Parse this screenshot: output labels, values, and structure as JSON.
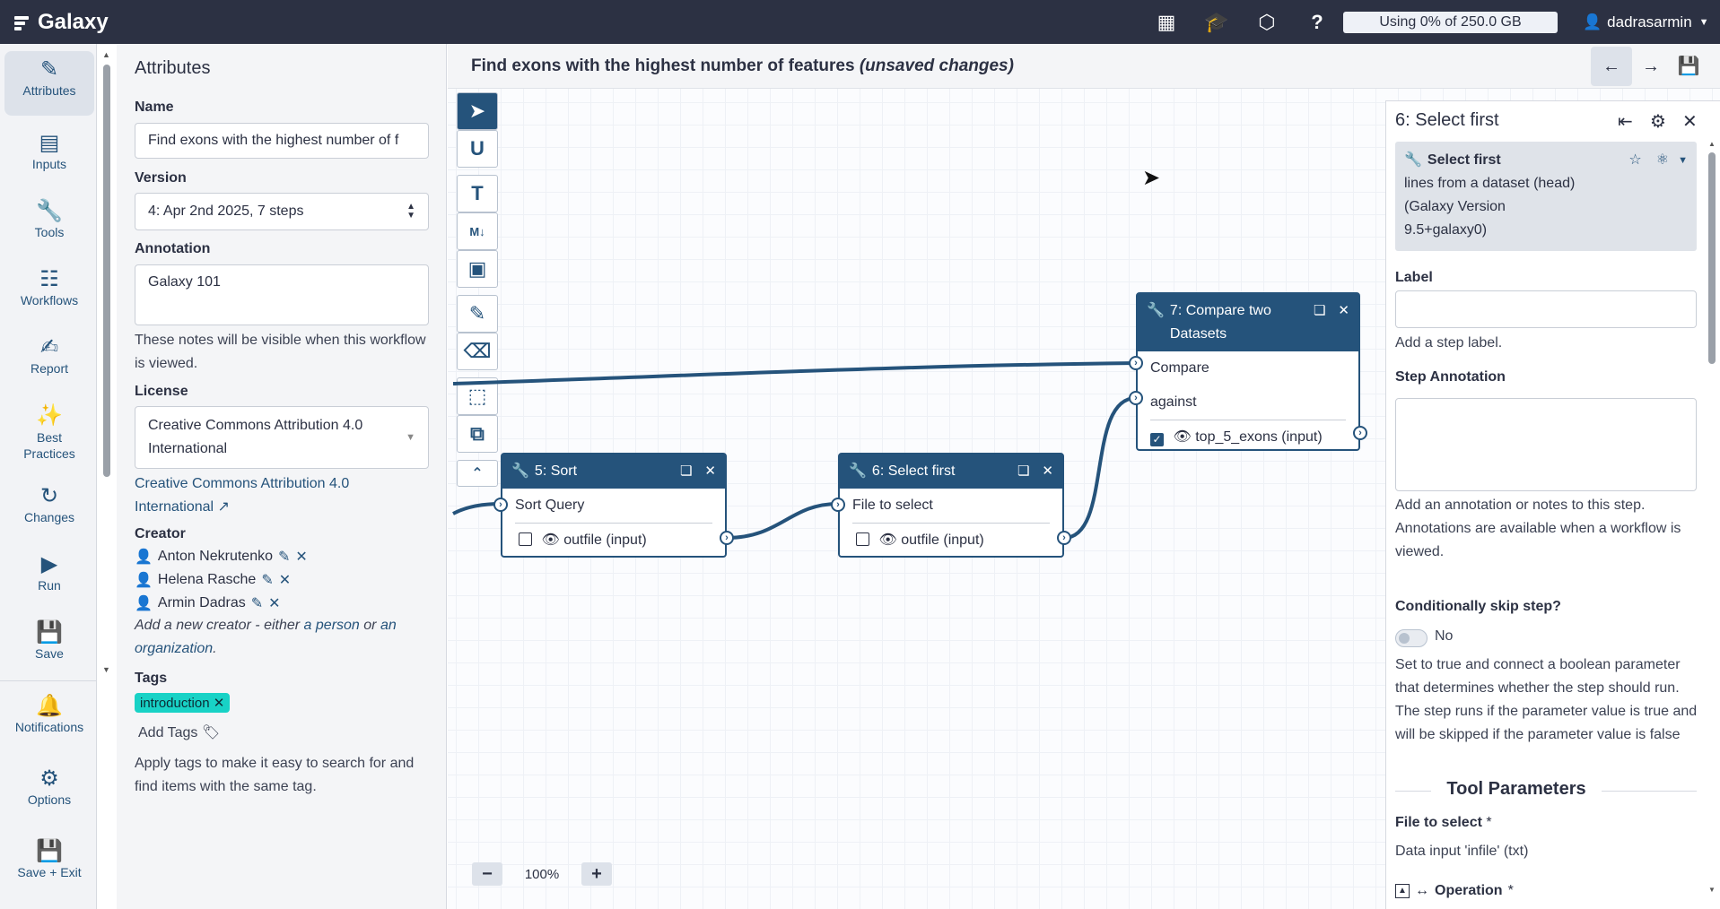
{
  "header": {
    "brand": "Galaxy",
    "icons": [
      "apps-grid-icon",
      "graduation-cap-icon",
      "interactive-tools-icon",
      "help-icon"
    ],
    "quota": "Using 0% of 250.0 GB",
    "user": "dadrasarmin"
  },
  "activity_bar": {
    "items": [
      {
        "label": "Attributes",
        "icon": "pencil-icon"
      },
      {
        "label": "Inputs",
        "icon": "inputs-icon"
      },
      {
        "label": "Tools",
        "icon": "wrench-icon"
      },
      {
        "label": "Workflows",
        "icon": "sitemap-icon"
      },
      {
        "label": "Report",
        "icon": "edit-icon"
      },
      {
        "label": "Best Practices",
        "icon": "magic-icon"
      },
      {
        "label": "Changes",
        "icon": "history-icon"
      },
      {
        "label": "Run",
        "icon": "play-icon"
      },
      {
        "label": "Save",
        "icon": "save-icon"
      },
      {
        "label": "Notifications",
        "icon": "bell-icon"
      },
      {
        "label": "Options",
        "icon": "cog-icon"
      },
      {
        "label": "Save + Exit",
        "icon": "save-icon"
      }
    ]
  },
  "attributes": {
    "title": "Attributes",
    "name_label": "Name",
    "name_value": "Find exons with the highest number of f",
    "version_label": "Version",
    "version_value": "4: Apr 2nd 2025, 7 steps",
    "annotation_label": "Annotation",
    "annotation_value": "Galaxy 101",
    "annotation_help": "These notes will be visible when this workflow is viewed.",
    "license_label": "License",
    "license_line1": "Creative Commons Attribution 4.0",
    "license_line2": "International",
    "license_link1": "Creative Commons Attribution 4.0",
    "license_link2": "International",
    "creator_label": "Creator",
    "creators": [
      "Anton Nekrutenko",
      "Helena Rasche",
      "Armin Dadras"
    ],
    "creator_help_a": "Add a new creator - either ",
    "creator_help_person": "a person",
    "creator_help_or": " or ",
    "creator_help_an": "an",
    "creator_help_org": "organization",
    "creator_help_dot": ".",
    "tags_label": "Tags",
    "tag": "introduction",
    "add_tags": "Add Tags",
    "tags_help": "Apply tags to make it easy to search for and find items with the same tag."
  },
  "canvas": {
    "title": "Find exons with the highest number of features",
    "title_status": "(unsaved changes)",
    "zoom": "100%",
    "nodes": {
      "sort": {
        "title": "5: Sort",
        "input": "Sort Query",
        "output": "outfile (input)"
      },
      "select": {
        "title": "6: Select first",
        "input": "File to select",
        "output": "outfile (input)"
      },
      "compare": {
        "title": "7: Compare two Datasets",
        "input1": "Compare",
        "input2": "against",
        "output": "top_5_exons (input)"
      }
    }
  },
  "step_panel": {
    "title": "6: Select first",
    "tool_name": "Select first",
    "tool_desc": "lines from a dataset (head)",
    "tool_version": "(Galaxy Version",
    "tool_version2": "9.5+galaxy0)",
    "label_label": "Label",
    "label_help": "Add a step label.",
    "annotation_label": "Step Annotation",
    "annotation_help": "Add an annotation or notes to this step. Annotations are available when a workflow is viewed.",
    "skip_label": "Conditionally skip step?",
    "skip_value": "No",
    "skip_help": "Set to true and connect a boolean parameter that determines whether the step should run. The step runs if the parameter value is true and will be skipped if the parameter value is false",
    "params_title": "Tool Parameters",
    "file_label": "File to select",
    "required_mark": "*",
    "file_value": "Data input 'infile' (txt)",
    "operation_label": "Operation"
  },
  "colors": {
    "navbar": "#2c3143",
    "node": "#25537b",
    "tag": "#18d2c6"
  }
}
